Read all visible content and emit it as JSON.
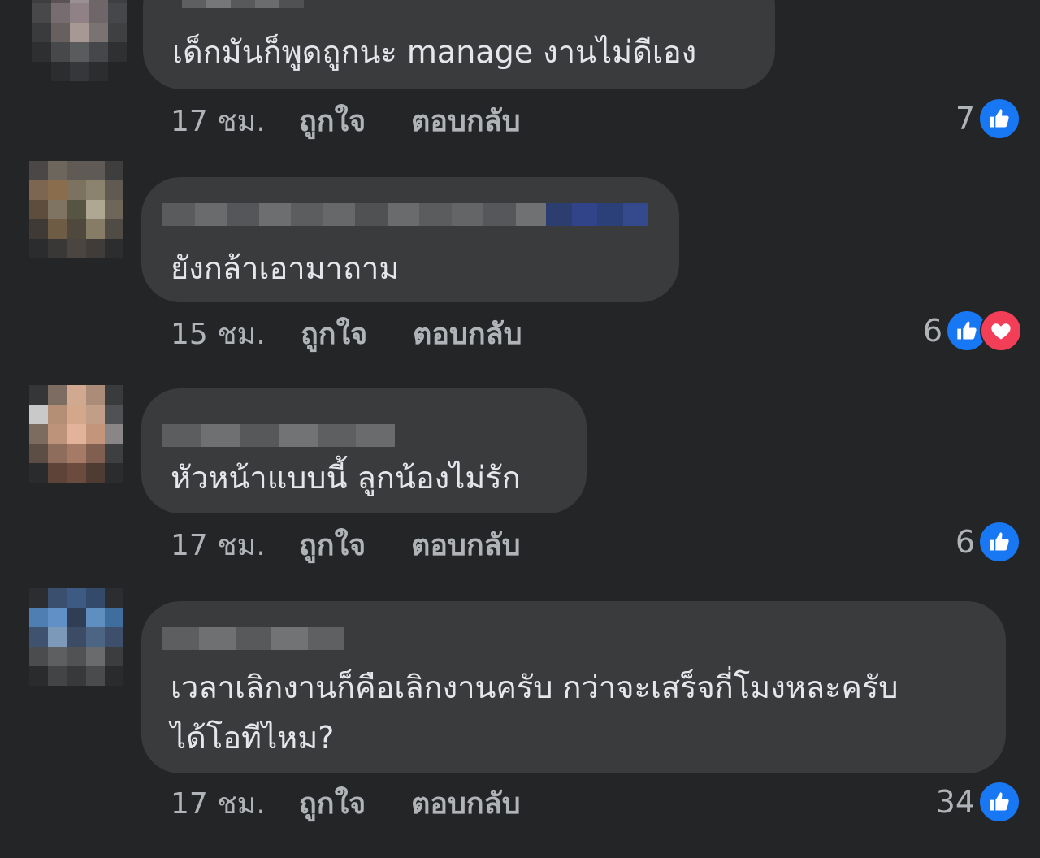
{
  "comments": [
    {
      "text": "เด็กมันก็พูดถูกนะ manage งานไม่ดีเอง",
      "time": "17 ชม.",
      "like_label": "ถูกใจ",
      "reply_label": "ตอบกลับ",
      "reaction_count": "7",
      "reactions": [
        "like"
      ]
    },
    {
      "text": "ยังกล้าเอามาถาม",
      "time": "15 ชม.",
      "like_label": "ถูกใจ",
      "reply_label": "ตอบกลับ",
      "reaction_count": "6",
      "reactions": [
        "like",
        "love"
      ]
    },
    {
      "text": "หัวหน้าแบบนี้ ลูกน้องไม่รัก",
      "time": "17 ชม.",
      "like_label": "ถูกใจ",
      "reply_label": "ตอบกลับ",
      "reaction_count": "6",
      "reactions": [
        "like"
      ]
    },
    {
      "text_lines": [
        "เวลาเลิกงานก็คือเลิกงานครับ กว่าจะเสร็จกี่โมงหละครับ",
        "ได้โอทีไหม?"
      ],
      "time": "17 ชม.",
      "like_label": "ถูกใจ",
      "reply_label": "ตอบกลับ",
      "reaction_count": "34",
      "reactions": [
        "like"
      ]
    }
  ],
  "colors": {
    "background": "#242527",
    "bubble": "#3a3b3c",
    "text": "#e4e6eb",
    "meta": "#b0b3b8",
    "like": "#1877f2",
    "love": "#f33e58"
  }
}
